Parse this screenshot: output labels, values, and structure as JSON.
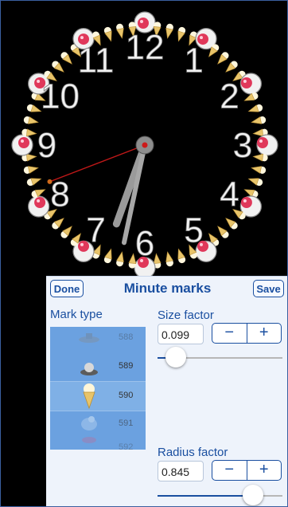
{
  "clock": {
    "numerals": [
      "12",
      "1",
      "2",
      "3",
      "4",
      "5",
      "6",
      "7",
      "8",
      "9",
      "10",
      "11"
    ],
    "hour_fraction": 0.555,
    "minute_value": 32,
    "second_value": 41.5
  },
  "panel": {
    "done_label": "Done",
    "title": "Minute marks",
    "save_label": "Save",
    "mark_type_label": "Mark type",
    "picker_items": [
      "588",
      "589",
      "590",
      "591",
      "592"
    ],
    "selected_item": "590",
    "size_factor_label": "Size factor",
    "size_factor_value": "0.099",
    "size_factor_level": 0.08,
    "radius_factor_label": "Radius factor",
    "radius_factor_value": "0.845",
    "radius_factor_level": 0.82,
    "minus": "−",
    "plus": "+"
  },
  "colors": {
    "accent": "#1a4fa0",
    "picker": "#6ba1e0",
    "ornament_red": "#e0385a",
    "cone": "#e8c46a"
  }
}
